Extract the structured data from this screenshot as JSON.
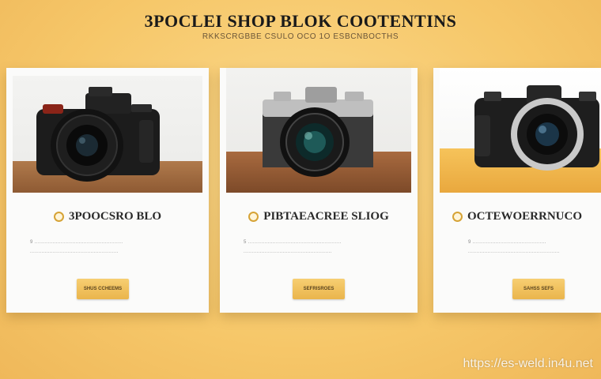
{
  "header": {
    "title": "3POCLEI SHOP BLOK COOTENTINS",
    "subtitle": "RKKSCRGBBE CSULO   OCO 1O   ESBCNBOCTHS"
  },
  "cards": [
    {
      "title": "3POOCSRO BLO",
      "text_lines": [
        "9 ......................................................",
        "......................................................"
      ],
      "button_label": "SHUS CCHEEMS"
    },
    {
      "title": "PIBTAEACREE SLIOG",
      "text_lines": [
        "5 .........................................................",
        "......................................................"
      ],
      "button_label": "SEFRISROES"
    },
    {
      "title": "OCTEWOERRNUCO",
      "text_lines": [
        "9 .............................................",
        "........................................................"
      ],
      "button_label": "SAHSS SEFS"
    }
  ],
  "watermark": "https://es-weld.in4u.net",
  "colors": {
    "background": "#f6c769",
    "button": "#eab54c",
    "card": "#fbfbfa",
    "badge_ring": "#d6a336"
  }
}
